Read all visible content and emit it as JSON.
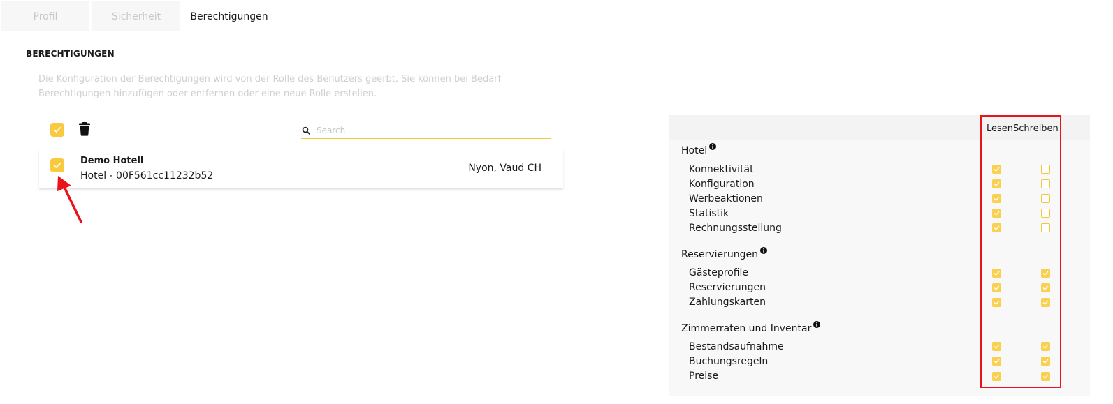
{
  "tabs": [
    {
      "label": "Profil",
      "active": false
    },
    {
      "label": "Sicherheit",
      "active": false
    },
    {
      "label": "Berechtigungen",
      "active": true
    }
  ],
  "section": {
    "title": "BERECHTIGUNGEN",
    "description": "Die Konfiguration der Berechtigungen wird von der Rolle des Benutzers geerbt, Sie können bei Bedarf Berechtigungen hinzufügen oder entfernen oder eine neue Rolle erstellen."
  },
  "toolbar": {
    "select_all_checked": true,
    "search_placeholder": "Search"
  },
  "hotel": {
    "checked": true,
    "name": "Demo Hotell",
    "sub": "Hotel - 00F561cc11232b52",
    "location": "Nyon, Vaud CH"
  },
  "permissions": {
    "columns": {
      "read": "Lesen",
      "write": "Schreiben"
    },
    "groups": [
      {
        "title": "Hotel",
        "items": [
          {
            "label": "Konnektivität",
            "read": true,
            "write": false
          },
          {
            "label": "Konfiguration",
            "read": true,
            "write": false
          },
          {
            "label": "Werbeaktionen",
            "read": true,
            "write": false
          },
          {
            "label": "Statistik",
            "read": true,
            "write": false
          },
          {
            "label": "Rechnungsstellung",
            "read": true,
            "write": false
          }
        ]
      },
      {
        "title": "Reservierungen",
        "items": [
          {
            "label": "Gästeprofile",
            "read": true,
            "write": true
          },
          {
            "label": "Reservierungen",
            "read": true,
            "write": true
          },
          {
            "label": "Zahlungskarten",
            "read": true,
            "write": true
          }
        ]
      },
      {
        "title": "Zimmerraten und Inventar",
        "items": [
          {
            "label": "Bestandsaufnahme",
            "read": true,
            "write": true
          },
          {
            "label": "Buchungsregeln",
            "read": true,
            "write": true
          },
          {
            "label": "Preise",
            "read": true,
            "write": true
          }
        ]
      }
    ]
  },
  "colors": {
    "accent": "#f9c940",
    "highlight": "#e8141a"
  }
}
